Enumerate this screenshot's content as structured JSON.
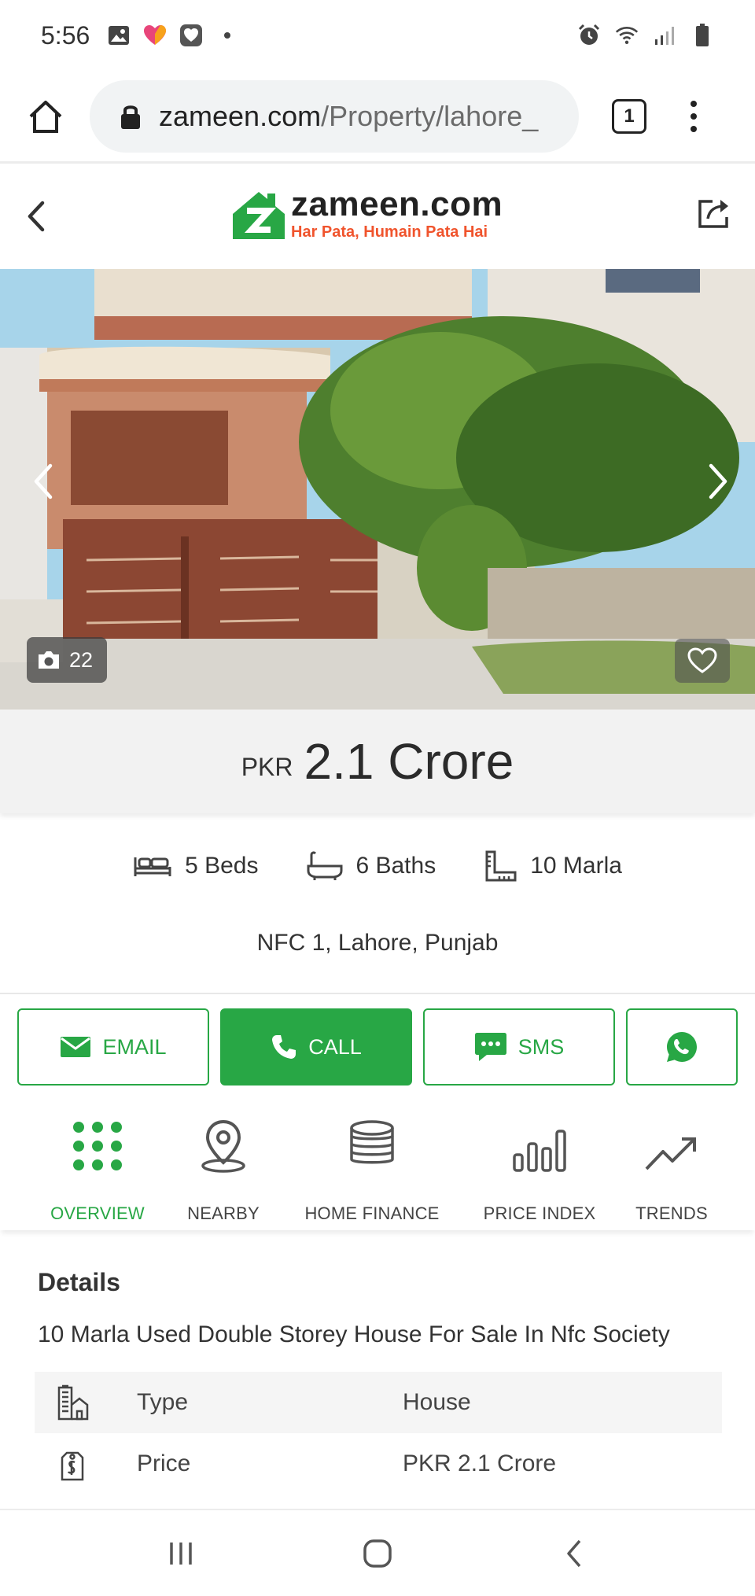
{
  "status_bar": {
    "time": "5:56",
    "left_icons": [
      "gallery-icon",
      "heart-app-icon",
      "shield-heart-icon",
      "dot-icon"
    ],
    "right_icons": [
      "alarm-icon",
      "wifi-icon",
      "signal-icon",
      "battery-icon"
    ]
  },
  "browser": {
    "url_domain": "zameen.com",
    "url_path": "/Property/lahore_",
    "tab_count": "1"
  },
  "site": {
    "logo_name": "zameen.com",
    "logo_tagline": "Har Pata, Humain Pata Hai",
    "brand_green": "#28a745",
    "brand_orange": "#f0542d"
  },
  "hero": {
    "photo_count": "22"
  },
  "price": {
    "currency": "PKR",
    "value": "2.1 Crore"
  },
  "features": [
    {
      "icon": "bed-icon",
      "label": "5 Beds"
    },
    {
      "icon": "bath-icon",
      "label": "6 Baths"
    },
    {
      "icon": "area-icon",
      "label": "10 Marla"
    }
  ],
  "location": "NFC 1, Lahore, Punjab",
  "actions": {
    "email": "EMAIL",
    "call": "CALL",
    "sms": "SMS",
    "whatsapp_icon": "whatsapp-icon"
  },
  "nav_tabs": [
    {
      "label": "OVERVIEW",
      "icon": "grid-dots-icon",
      "active": true
    },
    {
      "label": "NEARBY",
      "icon": "map-pin-icon",
      "active": false
    },
    {
      "label": "HOME FINANCE",
      "icon": "coins-icon",
      "active": false
    },
    {
      "label": "PRICE INDEX",
      "icon": "bars-icon",
      "active": false
    },
    {
      "label": "TRENDS",
      "icon": "trend-icon",
      "active": false
    }
  ],
  "details": {
    "title": "Details",
    "description": "10 Marla Used Double Storey House For Sale In Nfc Society",
    "rows": [
      {
        "icon": "building-icon",
        "key": "Type",
        "value": "House"
      },
      {
        "icon": "price-tag-icon",
        "key": "Price",
        "value": "PKR  2.1 Crore"
      }
    ]
  }
}
